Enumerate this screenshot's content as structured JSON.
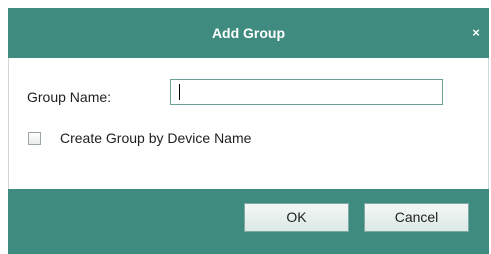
{
  "dialog": {
    "title": "Add Group",
    "close_glyph": "×",
    "group_name_label": "Group Name:",
    "group_name_value": "",
    "create_by_device_label": "Create Group by Device Name",
    "create_by_device_checked": false,
    "ok_label": "OK",
    "cancel_label": "Cancel"
  },
  "colors": {
    "header": "#3f8b80",
    "footer": "#3f8b80",
    "input_border": "#6a9e96"
  },
  "icons": {
    "close": "close-icon"
  }
}
